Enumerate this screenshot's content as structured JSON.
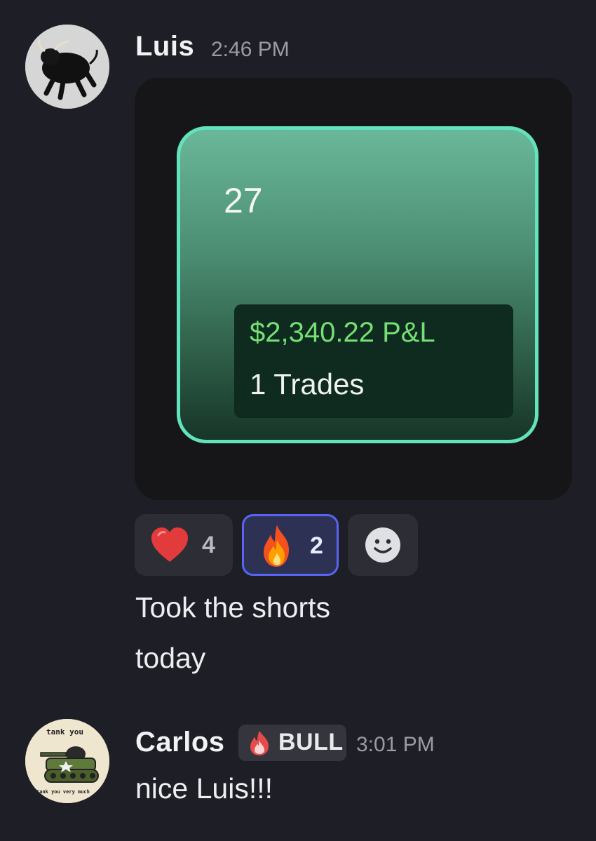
{
  "messages": [
    {
      "author": "Luis",
      "time": "2:46 PM",
      "avatar_icon": "bull-avatar",
      "attachment": {
        "day": "27",
        "pnl": "$2,340.22 P&L",
        "trades": "1 Trades",
        "colors": {
          "border": "#63e3bb",
          "gradient_top": "#6ab79a",
          "gradient_bottom": "#173528",
          "pnl_text": "#75df76"
        }
      },
      "reactions": [
        {
          "emoji_icon": "heart-icon",
          "count": "4",
          "active": false
        },
        {
          "emoji_icon": "fire-icon",
          "count": "2",
          "active": true
        }
      ],
      "add_reaction_icon": "smiley-icon",
      "lines": [
        "Took the shorts",
        "today"
      ]
    },
    {
      "author": "Carlos",
      "time": "3:01 PM",
      "avatar_icon": "tank-avatar",
      "avatar_text_top": "tank you",
      "avatar_text_bottom": "tank you very much",
      "role": {
        "icon": "flame-role-icon",
        "label": "BULL"
      },
      "lines": [
        "nice Luis!!!"
      ]
    }
  ],
  "colors": {
    "background": "#1e1f26",
    "accent": "#5865f2",
    "timestamp": "#9a9ba3"
  }
}
